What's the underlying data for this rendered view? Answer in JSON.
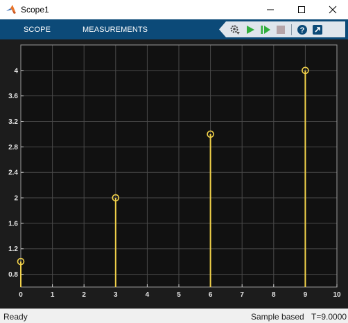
{
  "window": {
    "title": "Scope1"
  },
  "toolstrip": {
    "tabs": [
      {
        "label": "SCOPE"
      },
      {
        "label": "MEASUREMENTS"
      }
    ],
    "tools": [
      {
        "icon": "settings-gear-icon"
      },
      {
        "icon": "run-icon"
      },
      {
        "icon": "step-forward-icon"
      },
      {
        "icon": "stop-icon"
      },
      {
        "icon": "help-icon"
      },
      {
        "icon": "undock-icon"
      }
    ]
  },
  "status": {
    "left": "Ready",
    "mode": "Sample based",
    "time": "T=9.0000"
  },
  "colors": {
    "toolstrip": "#0c4a78",
    "plot_background": "#111111",
    "figure_background": "#1c1c1c",
    "grid": "#4a4a4a",
    "stem": "#f2d24a",
    "tick_text": "#e6e6e6"
  },
  "chart_data": {
    "type": "stem",
    "x": [
      0,
      3,
      6,
      9
    ],
    "y": [
      1,
      2,
      3,
      4
    ],
    "xlim": [
      0,
      10
    ],
    "ylim": [
      0.6,
      4.4
    ],
    "xticks": [
      "0",
      "1",
      "2",
      "3",
      "4",
      "5",
      "6",
      "7",
      "8",
      "9",
      "10"
    ],
    "yticks": [
      "0.8",
      "1.2",
      "1.6",
      "2",
      "2.4",
      "2.8",
      "3.2",
      "3.6",
      "4"
    ],
    "grid": true,
    "title": "",
    "xlabel": "",
    "ylabel": ""
  }
}
